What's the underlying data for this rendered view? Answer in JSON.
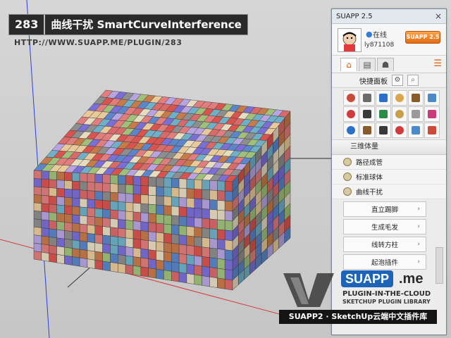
{
  "header": {
    "number": "283",
    "title": "曲线干扰 SmartCurveInterference",
    "url": "HTTP://WWW.SUAPP.ME/PLUGIN/283"
  },
  "viewport": {
    "watermark_text": "ME",
    "cube_colors": [
      "#d9534f",
      "#7b6fd6",
      "#e8c99a",
      "#c77a4a",
      "#6fb0c8",
      "#e27d7d",
      "#8e8e8e",
      "#b7a4e0",
      "#e6dcc0",
      "#5c86c9",
      "#d96a6a",
      "#a0c07a"
    ]
  },
  "panel": {
    "title": "SUAPP 2.5",
    "close": "×",
    "status": "在线",
    "username": "ly871108",
    "badge": "SUAPP 2.5",
    "quick_panel": "快捷面板",
    "section": "三维体量",
    "items": [
      "路径成管",
      "标准球体",
      "曲线干扰"
    ],
    "buttons": [
      "直立踢脚",
      "生成毛发",
      "线转方柱",
      "起泡插件"
    ]
  },
  "brand": {
    "suapp": "SUAPP",
    "me": ".me",
    "cloud": "PLUGIN-IN-THE-CLOUD",
    "library": "SKETCHUP PLUGIN LIBRARY",
    "banner": "SUAPP2 · SketchUp云端中文插件库"
  },
  "icons": {
    "close": "close-icon",
    "online": "user-icon",
    "home": "home-icon",
    "doc": "document-icon",
    "user": "user-icon",
    "menu": "menu-icon",
    "settings": "gear-icon",
    "search": "search-icon"
  }
}
